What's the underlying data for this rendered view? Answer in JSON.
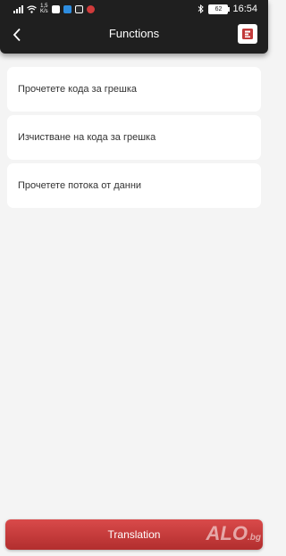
{
  "status_bar": {
    "net_speed_value": "1,5",
    "net_speed_unit": "K/s",
    "battery_level": "62",
    "time": "16:54"
  },
  "header": {
    "title": "Functions",
    "back_icon": "chevron-left-icon",
    "logo_icon": "brand-logo-icon"
  },
  "functions": [
    {
      "label": "Прочетете кода за грешка"
    },
    {
      "label": "Изчистване на кода за грешка"
    },
    {
      "label": "Прочетете потока от данни"
    }
  ],
  "bottom_button": {
    "label": "Translation"
  },
  "watermark": {
    "brand": "ALO",
    "suffix": ".bg"
  },
  "colors": {
    "header_bg": "#1f1f1f",
    "page_bg": "#f4f4f4",
    "accent": "#c23a3a"
  }
}
